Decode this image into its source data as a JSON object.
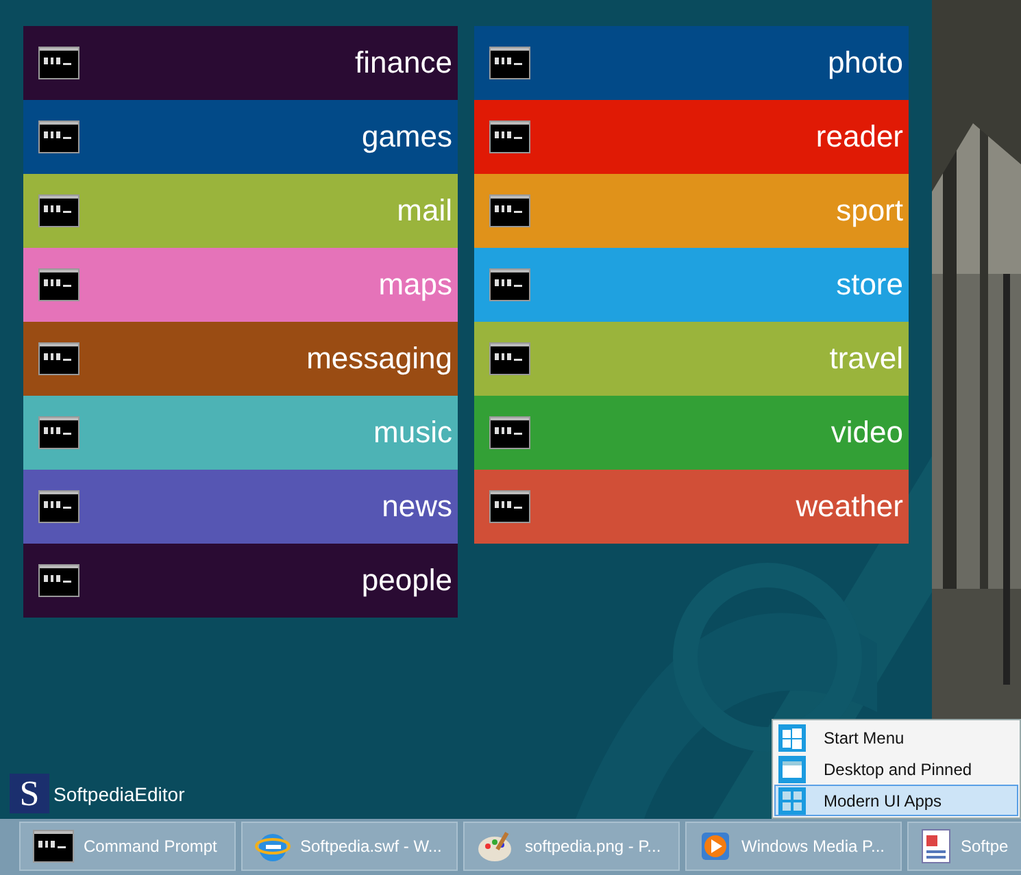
{
  "tile_columns": [
    {
      "tiles": [
        {
          "label": "finance",
          "color": "#2a0b33"
        },
        {
          "label": "games",
          "color": "#024a88"
        },
        {
          "label": "mail",
          "color": "#9ab43c"
        },
        {
          "label": "maps",
          "color": "#e573b9"
        },
        {
          "label": "messaging",
          "color": "#9a4c13"
        },
        {
          "label": "music",
          "color": "#4db3b5"
        },
        {
          "label": "news",
          "color": "#5656b3"
        },
        {
          "label": "people",
          "color": "#2a0b33"
        }
      ]
    },
    {
      "tiles": [
        {
          "label": "photo",
          "color": "#024a88"
        },
        {
          "label": "reader",
          "color": "#e01a05"
        },
        {
          "label": "sport",
          "color": "#e0921a"
        },
        {
          "label": "store",
          "color": "#1fa1e0"
        },
        {
          "label": "travel",
          "color": "#9ab43c"
        },
        {
          "label": "video",
          "color": "#33a036"
        },
        {
          "label": "weather",
          "color": "#d14f37"
        }
      ]
    }
  ],
  "user": {
    "initial": "S",
    "name": "SoftpediaEditor"
  },
  "menu": [
    {
      "label": "Start Menu",
      "kind": "windows",
      "selected": false
    },
    {
      "label": "Desktop and Pinned",
      "kind": "window",
      "selected": false
    },
    {
      "label": "Modern UI Apps",
      "kind": "apps",
      "selected": true
    }
  ],
  "taskbar": [
    {
      "label": "Command Prompt",
      "kind": "console"
    },
    {
      "label": "Softpedia.swf - W...",
      "kind": "browser"
    },
    {
      "label": "softpedia.png - P...",
      "kind": "paint"
    },
    {
      "label": "Windows Media P...",
      "kind": "media"
    },
    {
      "label": "Softpe",
      "kind": "document"
    }
  ]
}
